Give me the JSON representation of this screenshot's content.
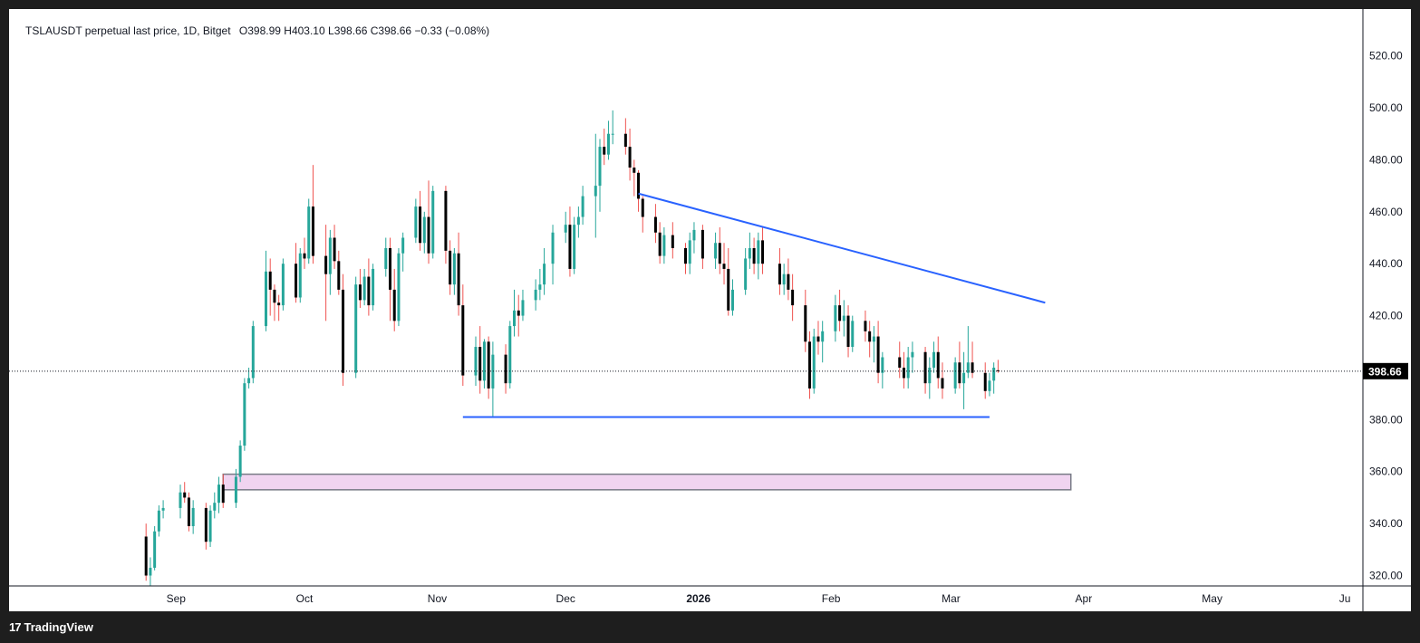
{
  "legend": {
    "symbol": "TSLAUSDT perpetual last price, 1D, Bitget",
    "o_label": "O",
    "o_value": "398.99",
    "h_label": "H",
    "h_value": "403.10",
    "l_label": "L",
    "l_value": "398.66",
    "c_label": "C",
    "c_value": "398.66",
    "change": "−0.33 (−0.08%)"
  },
  "footer": {
    "brand": "TradingView",
    "mark": "17"
  },
  "colors": {
    "up": "#26a69a",
    "up_wick": "#26a69a",
    "down": "#000000",
    "down_wick": "#ef5350",
    "trendline": "#2962ff",
    "zone_fill": "#f0d4f0",
    "zone_border": "#787b86",
    "price_tag_bg": "#000000",
    "price_tag_text": "#ffffff"
  },
  "chart_data": {
    "type": "candlestick",
    "title": "TSLAUSDT perpetual last price, 1D, Bitget",
    "x_ticks": [
      {
        "label": "Sep",
        "date": "2025-09-01"
      },
      {
        "label": "Oct",
        "date": "2025-10-01"
      },
      {
        "label": "Nov",
        "date": "2025-11-01"
      },
      {
        "label": "Dec",
        "date": "2025-12-01"
      },
      {
        "label": "2026",
        "date": "2026-01-01",
        "bold": true
      },
      {
        "label": "Feb",
        "date": "2026-02-01"
      },
      {
        "label": "Mar",
        "date": "2026-03-01"
      },
      {
        "label": "Apr",
        "date": "2026-04-01"
      },
      {
        "label": "May",
        "date": "2026-05-01"
      },
      {
        "label": "Ju",
        "date": "2026-06-01"
      }
    ],
    "y_ticks": [
      320,
      340,
      360,
      380,
      400,
      420,
      440,
      460,
      480,
      500,
      520
    ],
    "y_tick_labels": [
      "320.00",
      "340.00",
      "360.00",
      "380.00",
      "400.00",
      "420.00",
      "440.00",
      "460.00",
      "480.00",
      "500.00",
      "520.00"
    ],
    "ylim": [
      316,
      538
    ],
    "xlim": [
      "2025-07-24",
      "2026-06-05"
    ],
    "last_price": 398.66,
    "last_price_label": "398.66",
    "candles": [
      [
        "2025-08-25",
        335,
        340,
        318,
        320
      ],
      [
        "2025-08-26",
        320,
        327,
        316,
        323
      ],
      [
        "2025-08-27",
        323,
        339,
        322,
        337
      ],
      [
        "2025-08-28",
        337,
        347,
        335,
        345
      ],
      [
        "2025-08-29",
        345,
        349,
        342,
        346
      ],
      [
        "2025-09-02",
        346,
        355,
        342,
        352
      ],
      [
        "2025-09-03",
        352,
        356,
        348,
        350
      ],
      [
        "2025-09-04",
        350,
        352,
        337,
        339
      ],
      [
        "2025-09-05",
        339,
        349,
        336,
        346
      ],
      [
        "2025-09-08",
        346,
        348,
        330,
        333
      ],
      [
        "2025-09-09",
        333,
        347,
        331,
        345
      ],
      [
        "2025-09-10",
        345,
        352,
        342,
        348
      ],
      [
        "2025-09-11",
        348,
        358,
        344,
        355
      ],
      [
        "2025-09-12",
        355,
        359,
        346,
        348
      ],
      [
        "2025-09-15",
        348,
        361,
        346,
        358
      ],
      [
        "2025-09-16",
        358,
        372,
        356,
        370
      ],
      [
        "2025-09-17",
        370,
        396,
        368,
        394
      ],
      [
        "2025-09-18",
        394,
        400,
        392,
        396
      ],
      [
        "2025-09-19",
        396,
        418,
        394,
        416
      ],
      [
        "2025-09-22",
        416,
        445,
        414,
        437
      ],
      [
        "2025-09-23",
        437,
        442,
        420,
        430
      ],
      [
        "2025-09-24",
        430,
        432,
        418,
        425
      ],
      [
        "2025-09-25",
        425,
        428,
        418,
        424
      ],
      [
        "2025-09-26",
        424,
        442,
        422,
        440
      ],
      [
        "2025-09-29",
        440,
        448,
        425,
        427
      ],
      [
        "2025-09-30",
        427,
        446,
        425,
        444
      ],
      [
        "2025-10-01",
        444,
        450,
        438,
        442
      ],
      [
        "2025-10-02",
        442,
        465,
        440,
        462
      ],
      [
        "2025-10-03",
        462,
        478,
        440,
        443
      ],
      [
        "2025-10-06",
        443,
        455,
        418,
        436
      ],
      [
        "2025-10-07",
        436,
        453,
        428,
        450
      ],
      [
        "2025-10-08",
        450,
        455,
        438,
        441
      ],
      [
        "2025-10-09",
        441,
        445,
        428,
        430
      ],
      [
        "2025-10-10",
        430,
        436,
        393,
        398
      ],
      [
        "2025-10-13",
        398,
        435,
        396,
        432
      ],
      [
        "2025-10-14",
        432,
        438,
        423,
        426
      ],
      [
        "2025-10-15",
        426,
        438,
        424,
        435
      ],
      [
        "2025-10-16",
        435,
        442,
        420,
        424
      ],
      [
        "2025-10-17",
        424,
        440,
        422,
        438
      ],
      [
        "2025-10-20",
        438,
        450,
        435,
        446
      ],
      [
        "2025-10-21",
        446,
        450,
        418,
        430
      ],
      [
        "2025-10-22",
        430,
        438,
        414,
        418
      ],
      [
        "2025-10-23",
        418,
        446,
        416,
        444
      ],
      [
        "2025-10-24",
        444,
        452,
        437,
        450
      ],
      [
        "2025-10-27",
        450,
        465,
        448,
        462
      ],
      [
        "2025-10-28",
        462,
        468,
        445,
        448
      ],
      [
        "2025-10-29",
        448,
        460,
        444,
        458
      ],
      [
        "2025-10-30",
        458,
        472,
        440,
        444
      ],
      [
        "2025-10-31",
        444,
        470,
        442,
        468
      ],
      [
        "2025-11-03",
        468,
        470,
        440,
        445
      ],
      [
        "2025-11-04",
        445,
        449,
        428,
        432
      ],
      [
        "2025-11-05",
        432,
        446,
        428,
        444
      ],
      [
        "2025-11-06",
        444,
        452,
        420,
        424
      ],
      [
        "2025-11-07",
        424,
        432,
        393,
        397
      ],
      [
        "2025-11-10",
        397,
        412,
        393,
        408
      ],
      [
        "2025-11-11",
        408,
        416,
        390,
        395
      ],
      [
        "2025-11-12",
        395,
        411,
        392,
        410
      ],
      [
        "2025-11-13",
        410,
        412,
        388,
        392
      ],
      [
        "2025-11-14",
        392,
        410,
        381,
        405
      ],
      [
        "2025-11-17",
        405,
        409,
        390,
        394
      ],
      [
        "2025-11-18",
        394,
        418,
        392,
        416
      ],
      [
        "2025-11-19",
        416,
        430,
        412,
        422
      ],
      [
        "2025-11-20",
        422,
        428,
        412,
        420
      ],
      [
        "2025-11-21",
        420,
        430,
        418,
        426
      ],
      [
        "2025-11-24",
        426,
        434,
        422,
        430
      ],
      [
        "2025-11-25",
        430,
        438,
        426,
        432
      ],
      [
        "2025-11-26",
        432,
        446,
        428,
        440
      ],
      [
        "2025-11-28",
        440,
        455,
        432,
        452
      ],
      [
        "2025-12-01",
        452,
        460,
        448,
        455
      ],
      [
        "2025-12-02",
        455,
        462,
        435,
        438
      ],
      [
        "2025-12-03",
        438,
        458,
        436,
        455
      ],
      [
        "2025-12-04",
        455,
        462,
        450,
        458
      ],
      [
        "2025-12-05",
        458,
        470,
        455,
        466
      ],
      [
        "2025-12-08",
        466,
        490,
        450,
        470
      ],
      [
        "2025-12-09",
        470,
        488,
        460,
        485
      ],
      [
        "2025-12-10",
        485,
        492,
        478,
        482
      ],
      [
        "2025-12-11",
        482,
        495,
        480,
        490
      ],
      [
        "2025-12-12",
        490,
        499,
        486,
        490
      ],
      [
        "2025-12-15",
        490,
        496,
        482,
        485
      ],
      [
        "2025-12-16",
        485,
        492,
        472,
        477
      ],
      [
        "2025-12-17",
        477,
        480,
        466,
        475
      ],
      [
        "2025-12-18",
        475,
        476,
        460,
        465
      ],
      [
        "2025-12-19",
        465,
        466,
        452,
        458
      ],
      [
        "2025-12-22",
        458,
        463,
        448,
        452
      ],
      [
        "2025-12-23",
        452,
        456,
        440,
        443
      ],
      [
        "2025-12-24",
        443,
        454,
        440,
        451
      ],
      [
        "2025-12-26",
        451,
        456,
        442,
        446
      ],
      [
        "2025-12-29",
        446,
        448,
        436,
        440
      ],
      [
        "2025-12-30",
        440,
        452,
        436,
        449
      ],
      [
        "2025-12-31",
        449,
        456,
        444,
        453
      ],
      [
        "2026-01-02",
        453,
        455,
        438,
        442
      ],
      [
        "2026-01-05",
        442,
        452,
        438,
        448
      ],
      [
        "2026-01-06",
        448,
        454,
        436,
        440
      ],
      [
        "2026-01-07",
        440,
        448,
        432,
        438
      ],
      [
        "2026-01-08",
        438,
        446,
        420,
        422
      ],
      [
        "2026-01-09",
        422,
        434,
        420,
        430
      ],
      [
        "2026-01-12",
        430,
        446,
        428,
        442
      ],
      [
        "2026-01-13",
        442,
        452,
        438,
        446
      ],
      [
        "2026-01-14",
        446,
        450,
        436,
        440
      ],
      [
        "2026-01-15",
        440,
        452,
        434,
        449
      ],
      [
        "2026-01-16",
        449,
        454,
        436,
        440
      ],
      [
        "2026-01-20",
        440,
        446,
        428,
        432
      ],
      [
        "2026-01-21",
        432,
        440,
        428,
        436
      ],
      [
        "2026-01-22",
        436,
        442,
        426,
        430
      ],
      [
        "2026-01-23",
        430,
        436,
        418,
        424
      ],
      [
        "2026-01-26",
        424,
        430,
        406,
        410
      ],
      [
        "2026-01-27",
        410,
        414,
        388,
        392
      ],
      [
        "2026-01-28",
        392,
        415,
        390,
        412
      ],
      [
        "2026-01-29",
        412,
        418,
        405,
        410
      ],
      [
        "2026-01-30",
        410,
        418,
        402,
        414
      ],
      [
        "2026-02-02",
        414,
        428,
        410,
        424
      ],
      [
        "2026-02-03",
        424,
        430,
        414,
        418
      ],
      [
        "2026-02-04",
        418,
        426,
        412,
        420
      ],
      [
        "2026-02-05",
        420,
        424,
        404,
        408
      ],
      [
        "2026-02-06",
        408,
        420,
        406,
        418
      ],
      [
        "2026-02-09",
        418,
        422,
        410,
        414
      ],
      [
        "2026-02-10",
        414,
        418,
        404,
        410
      ],
      [
        "2026-02-11",
        410,
        416,
        402,
        412
      ],
      [
        "2026-02-12",
        412,
        418,
        394,
        398
      ],
      [
        "2026-02-13",
        398,
        406,
        392,
        404
      ],
      [
        "2026-02-17",
        404,
        410,
        396,
        400
      ],
      [
        "2026-02-18",
        400,
        406,
        392,
        396
      ],
      [
        "2026-02-19",
        396,
        408,
        392,
        404
      ],
      [
        "2026-02-20",
        404,
        410,
        398,
        406
      ],
      [
        "2026-02-23",
        406,
        408,
        390,
        394
      ],
      [
        "2026-02-24",
        394,
        404,
        388,
        400
      ],
      [
        "2026-02-25",
        400,
        410,
        398,
        406
      ],
      [
        "2026-02-26",
        406,
        412,
        392,
        396
      ],
      [
        "2026-02-27",
        396,
        402,
        388,
        392
      ],
      [
        "2026-03-02",
        392,
        404,
        390,
        402
      ],
      [
        "2026-03-03",
        402,
        410,
        392,
        394
      ],
      [
        "2026-03-04",
        394,
        406,
        384,
        398
      ],
      [
        "2026-03-05",
        398,
        416,
        396,
        402
      ],
      [
        "2026-03-06",
        402,
        410,
        396,
        398
      ],
      [
        "2026-03-09",
        398,
        402,
        388,
        391
      ],
      [
        "2026-03-10",
        391,
        398,
        389,
        395
      ],
      [
        "2026-03-11",
        395,
        402,
        390,
        400
      ],
      [
        "2026-03-12",
        399,
        403,
        398,
        398.66
      ]
    ],
    "annotations": [
      {
        "type": "trendline",
        "from": [
          "2025-12-18",
          467
        ],
        "to": [
          "2026-03-23",
          425
        ]
      },
      {
        "type": "horizontal",
        "from": [
          "2025-11-07",
          381
        ],
        "to": [
          "2026-03-10",
          381
        ]
      },
      {
        "type": "zone",
        "from": [
          "2025-09-12",
          359
        ],
        "to": [
          "2026-03-29",
          353
        ]
      }
    ]
  }
}
